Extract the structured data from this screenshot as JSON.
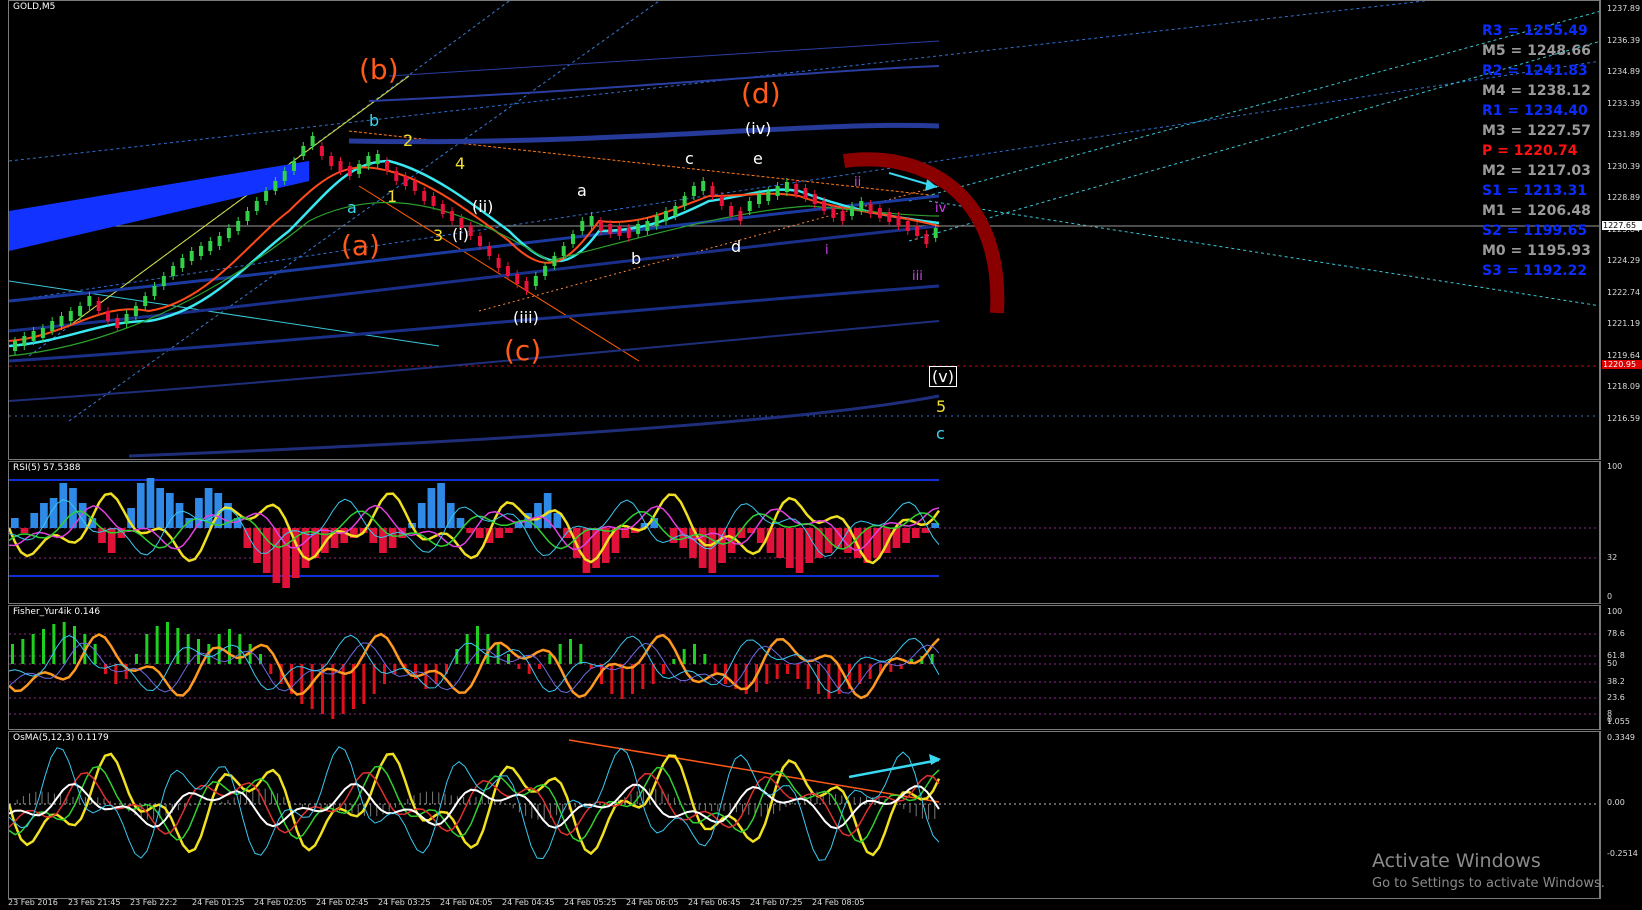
{
  "chart": {
    "symbol": "GOLD,M5",
    "price_ticks": [
      "1237.89",
      "1236.39",
      "1234.89",
      "1233.39",
      "1231.89",
      "1230.39",
      "1228.89",
      "1225.84",
      "1224.29",
      "1222.74",
      "1221.19",
      "1219.64",
      "1218.09",
      "1216.59"
    ],
    "current_price": "1227.65",
    "red_line_price": "1220.95",
    "pivots": [
      {
        "label": "R3 = 1255.49",
        "color": "#0a2cff"
      },
      {
        "label": "M5 = 1248.66",
        "color": "#9a9a9a"
      },
      {
        "label": "R2 = 1241.83",
        "color": "#0a2cff"
      },
      {
        "label": "M4 = 1238.12",
        "color": "#9a9a9a"
      },
      {
        "label": "R1 = 1234.40",
        "color": "#0a2cff"
      },
      {
        "label": "M3 = 1227.57",
        "color": "#9a9a9a"
      },
      {
        "label": "P  = 1220.74",
        "color": "#ff1010"
      },
      {
        "label": "M2 = 1217.03",
        "color": "#9a9a9a"
      },
      {
        "label": "S1 = 1213.31",
        "color": "#0a2cff"
      },
      {
        "label": "M1 = 1206.48",
        "color": "#9a9a9a"
      },
      {
        "label": "S2 = 1199.65",
        "color": "#0a2cff"
      },
      {
        "label": "M0 = 1195.93",
        "color": "#9a9a9a"
      },
      {
        "label": "S3 = 1192.22",
        "color": "#0a2cff"
      }
    ],
    "wave_labels": {
      "b_orange": "(b)",
      "a_orange": "(a)",
      "c_orange": "(c)",
      "d_orange": "(d)",
      "b_cyan": "b",
      "a_cyan": "a",
      "two": "2",
      "four": "4",
      "one": "1",
      "three": "3",
      "ii": "(ii)",
      "i": "(i)",
      "iii": "(iii)",
      "iv": "(iv)",
      "a_white": "a",
      "b_white": "b",
      "c_white": "c",
      "d_white": "d",
      "e_white": "e",
      "ii_mag": "ii",
      "i_mag": "i",
      "iii_mag": "iii",
      "iv_mag": "iv",
      "v_box": "(v)",
      "five_yellow": "5",
      "c_cyan2": "c"
    }
  },
  "rsi": {
    "title": "RSI(5) 57.5388",
    "ticks": [
      "100",
      "32",
      "0"
    ]
  },
  "fisher": {
    "title": "Fisher_Yur4ik 0.146",
    "ticks": [
      "100",
      "78.6",
      "61.8",
      "50",
      "38.2",
      "23.6",
      "8",
      "0",
      "1.055"
    ]
  },
  "osma": {
    "title": "OsMA(5,12,3) 0.1179",
    "ticks": [
      "0.3349",
      "0.00",
      "-0.2514"
    ]
  },
  "time_labels": [
    "23 Feb 2016",
    "23 Feb 21:45",
    "23 Feb 22:2",
    "24 Feb 01:25",
    "24 Feb 02:05",
    "24 Feb 02:45",
    "24 Feb 03:25",
    "24 Feb 04:05",
    "24 Feb 04:45",
    "24 Feb 05:25",
    "24 Feb 06:05",
    "24 Feb 06:45",
    "24 Feb 07:25",
    "24 Feb 08:05"
  ],
  "watermark": {
    "line1": "Activate Windows",
    "line2": "Go to Settings to activate Windows."
  }
}
